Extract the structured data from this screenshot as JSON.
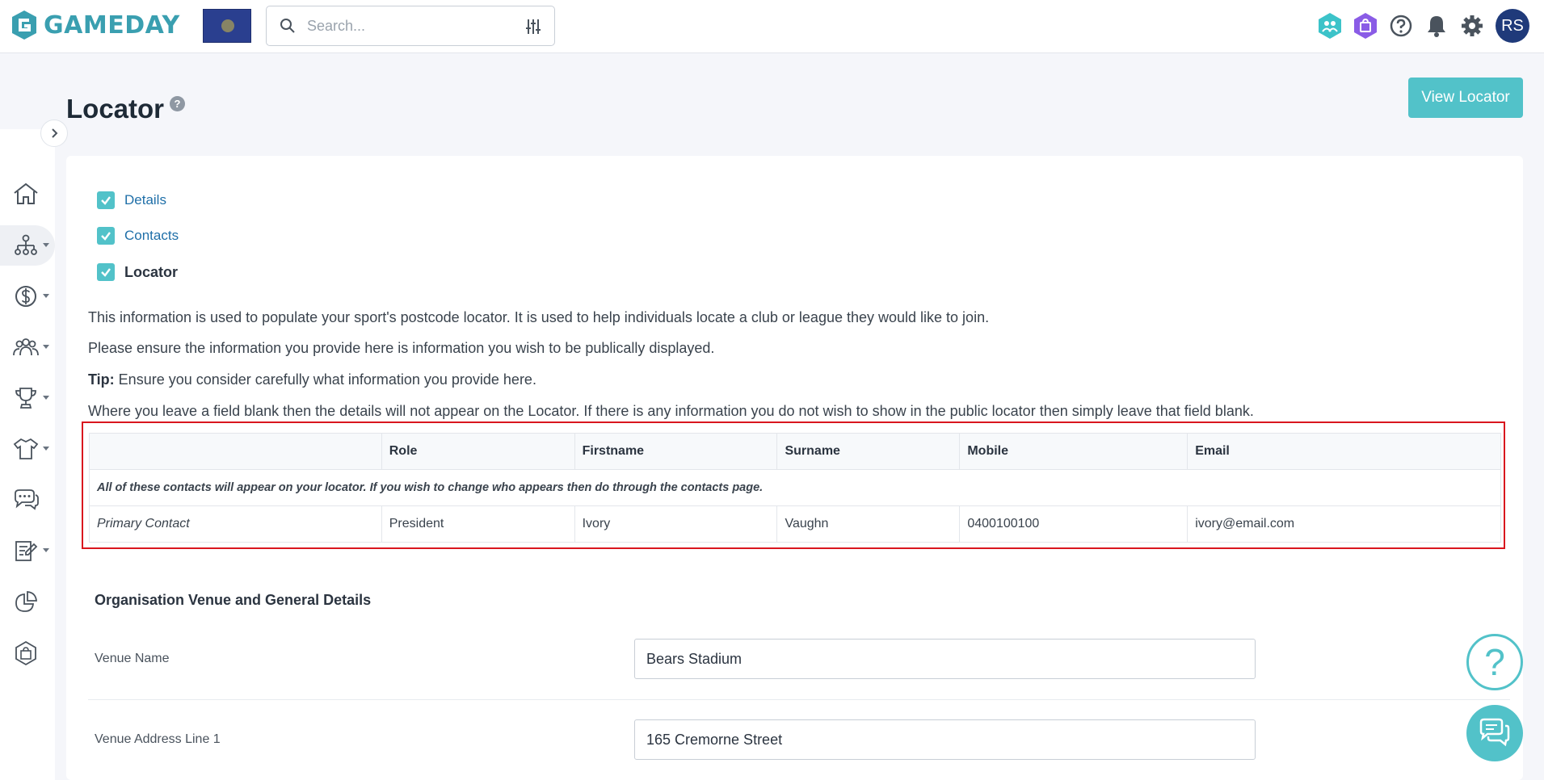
{
  "header": {
    "brand": "GAMEDAY",
    "search_placeholder": "Search...",
    "user_initials": "RS"
  },
  "page": {
    "title": "Locator",
    "help_mark": "?",
    "view_locator_label": "View Locator"
  },
  "steps": [
    {
      "label": "Details"
    },
    {
      "label": "Contacts"
    },
    {
      "label": "Locator"
    }
  ],
  "info": {
    "line1": "This information is used to populate your sport's postcode locator. It is used to help individuals locate a club or league they would like to join.",
    "line2": "Please ensure the information you provide here is information you wish to be publically displayed.",
    "tip_label": "Tip:",
    "tip_text": " Ensure you consider carefully what information you provide here.",
    "line4": "Where you leave a field blank then the details will not appear on the Locator. If there is any information you do not wish to show in the public locator then simply leave that field blank."
  },
  "contacts_table": {
    "headers": [
      "",
      "Role",
      "Firstname",
      "Surname",
      "Mobile",
      "Email"
    ],
    "note": "All of these contacts will appear on your locator. If you wish to change who appears then do through the contacts page.",
    "rows": [
      [
        "Primary Contact",
        "President",
        "Ivory",
        "Vaughn",
        "0400100100",
        "ivory@email.com"
      ]
    ]
  },
  "venue": {
    "section_title": "Organisation Venue and General Details",
    "fields": [
      {
        "label": "Venue Name",
        "value": "Bears Stadium"
      },
      {
        "label": "Venue Address Line 1",
        "value": "165 Cremorne Street"
      }
    ]
  },
  "fab": {
    "help_symbol": "?"
  },
  "colors": {
    "accent": "#52c2c9",
    "highlight": "#d9161e",
    "avatar": "#1f3a7a"
  }
}
